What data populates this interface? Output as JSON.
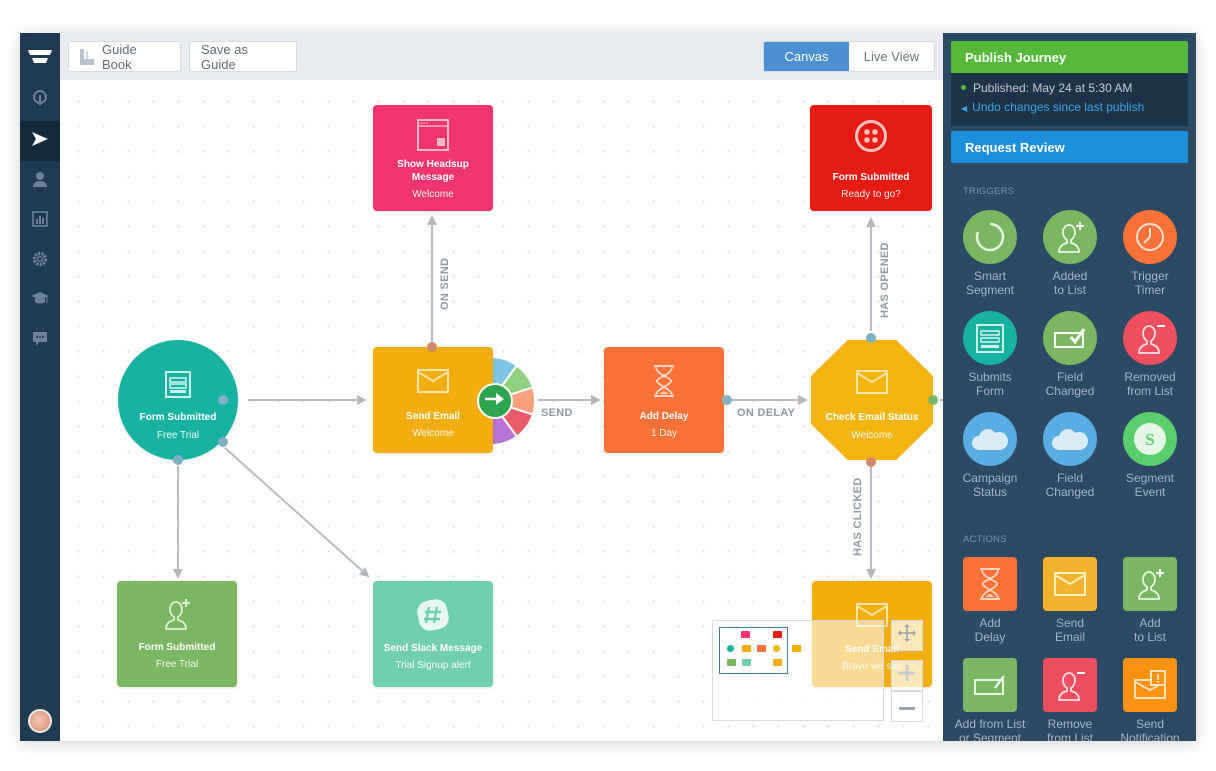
{
  "nav": {
    "items": [
      {
        "icon": "pin-icon",
        "active": false
      },
      {
        "icon": "send-icon",
        "active": true
      },
      {
        "icon": "user-icon",
        "active": false
      },
      {
        "icon": "report-icon",
        "active": false
      },
      {
        "icon": "gear-icon",
        "active": false
      },
      {
        "icon": "graduation-cap-icon",
        "active": false
      },
      {
        "icon": "chat-icon",
        "active": false
      }
    ]
  },
  "toolbar": {
    "guide_book": "Guide Book",
    "save_as_guide": "Save as Guide",
    "view_toggle": {
      "canvas": "Canvas",
      "live_view": "Live View",
      "selected": "Canvas"
    }
  },
  "canvas": {
    "nodes": {
      "form_submitted_trigger": {
        "title": "Form Submitted",
        "subtitle": "Free Trial",
        "color": "#17b3a0"
      },
      "show_headsup": {
        "title": "Show Headsup Message",
        "subtitle": "Welcome",
        "color": "#ef3470"
      },
      "send_email": {
        "title": "Send Email",
        "subtitle": "Welcome",
        "color": "#f2ae0f"
      },
      "add_delay": {
        "title": "Add Delay",
        "subtitle": "1 Day",
        "color": "#fa7238"
      },
      "check_email_status": {
        "title": "Check Email Status",
        "subtitle": "Welcome",
        "color": "#f2b50f"
      },
      "form_submitted_twilio": {
        "title": "Form Submitted",
        "subtitle": "Ready to go?",
        "color": "#e51c14"
      },
      "form_submitted_add": {
        "title": "Form Submitted",
        "subtitle": "Free Trial",
        "color": "#7bb662"
      },
      "send_slack": {
        "title": "Send Slack Message",
        "subtitle": "Trial Signup alert",
        "color": "#72cfae"
      },
      "send_email_2": {
        "title": "Send Email",
        "subtitle": "Bravo we say",
        "color": "#f2ae0f"
      }
    },
    "edge_labels": {
      "on_send": "ON SEND",
      "send": "SEND",
      "on_delay": "ON DELAY",
      "has_opened": "HAS OPENED",
      "has_clicked": "HAS CLICKED"
    },
    "split_wheel_colors": [
      "#7ec4e4",
      "#90d180",
      "#f6a17c",
      "#ea5a6a",
      "#b873d6"
    ]
  },
  "panel": {
    "publish_label": "Publish Journey",
    "published_status": "Published: May 24 at 5:30 AM",
    "undo_link": "Undo changes since last publish",
    "request_review": "Request Review",
    "triggers_heading": "TRIGGERS",
    "triggers": [
      {
        "line1": "Smart",
        "line2": "Segment",
        "color": "#7bb662",
        "icon": "smart-segment-icon"
      },
      {
        "line1": "Added",
        "line2": "to List",
        "color": "#7bb662",
        "icon": "user-plus-icon"
      },
      {
        "line1": "Trigger",
        "line2": "Timer",
        "color": "#fa7238",
        "icon": "clock-icon"
      },
      {
        "line1": "Submits",
        "line2": "Form",
        "color": "#17b3a0",
        "icon": "form-icon"
      },
      {
        "line1": "Field",
        "line2": "Changed",
        "color": "#7bb662",
        "icon": "field-check-icon"
      },
      {
        "line1": "Removed",
        "line2": "from List",
        "color": "#ee4f5f",
        "icon": "user-minus-icon"
      },
      {
        "line1": "Campaign",
        "line2": "Status",
        "color": "#5aade0",
        "icon": "salesforce-cloud-icon"
      },
      {
        "line1": "Field",
        "line2": "Changed",
        "color": "#5aade0",
        "icon": "salesforce-cloud-icon"
      },
      {
        "line1": "Segment",
        "line2": "Event",
        "color": "#5ccd6c",
        "icon": "segment-s-icon"
      }
    ],
    "actions_heading": "ACTIONS",
    "actions": [
      {
        "line1": "Add",
        "line2": "Delay",
        "color": "#fa7238",
        "icon": "hourglass-icon"
      },
      {
        "line1": "Send",
        "line2": "Email",
        "color": "#f2b32f",
        "icon": "envelope-icon"
      },
      {
        "line1": "Add",
        "line2": "to List",
        "color": "#7bb662",
        "icon": "user-plus-icon"
      },
      {
        "line1": "Add from List",
        "line2": "or Segment",
        "color": "#7bb662",
        "icon": "field-edit-icon"
      },
      {
        "line1": "Remove",
        "line2": "from List",
        "color": "#ee4f5f",
        "icon": "user-minus-icon"
      },
      {
        "line1": "Send",
        "line2": "Notification",
        "color": "#fb9212",
        "icon": "notification-icon"
      }
    ]
  }
}
